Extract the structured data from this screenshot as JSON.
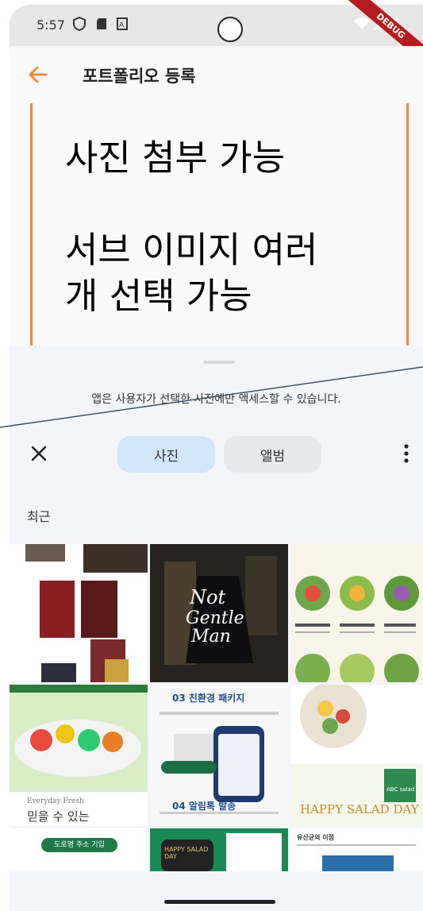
{
  "status_bar": {
    "time": "5:57",
    "debug_label": "DEBUG"
  },
  "app_bar": {
    "title": "포트폴리오 등록"
  },
  "note": {
    "text": "사진 첨부 가능\n\n서브 이미지 여러\n개 선택 가능"
  },
  "picker": {
    "access_notice": "앱은 사용자가 선택한 사진에만 액세스할 수 있습니다.",
    "tabs": [
      {
        "label": "사진",
        "selected": true
      },
      {
        "label": "앨범",
        "selected": false
      }
    ],
    "section_label": "최근",
    "thumbnails": {
      "t2_text": "Not\nGentle\nMan",
      "t5_heading1": "03 친환경 패키지",
      "t5_heading2": "04 알림톡 발송",
      "t6_brand": "ABC salad",
      "t6_tagline": "HAPPY SALAD DAY",
      "t4_text1": "Everyday Fresh",
      "t4_text2": "믿을 수 있는",
      "t7_text": "도로명 주소 기입",
      "t8_text": "HAPPY SALAD DAY",
      "t9_text": "유산균의 이점"
    }
  },
  "colors": {
    "accent_orange": "#f28a3c",
    "tab_selected": "#cfe6fb",
    "tab_unselected": "#e6e8ee"
  }
}
